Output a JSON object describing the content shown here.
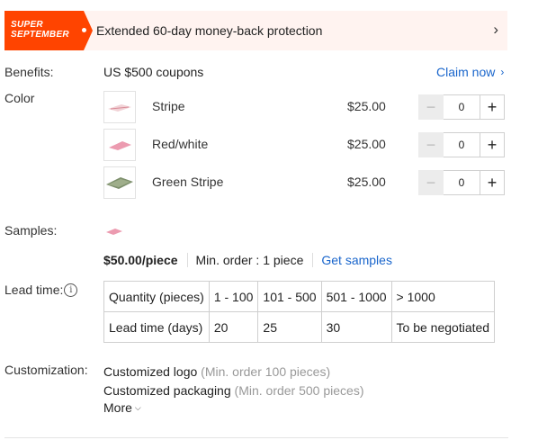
{
  "banner": {
    "badge_line1": "SUPER",
    "badge_line2": "SEPTEMBER",
    "text": "Extended 60-day money-back protection",
    "chevron": "›",
    "badge_color": "#ff4400",
    "background": "#fff3f0"
  },
  "benefits": {
    "label": "Benefits:",
    "value": "US $500 coupons",
    "claim_label": "Claim now",
    "claim_chevron": "›",
    "link_color": "#1a66cc"
  },
  "color": {
    "label": "Color",
    "options": [
      {
        "name": "Stripe",
        "price": "$25.00",
        "quantity": "0",
        "thumb_color": "#e8b9c0"
      },
      {
        "name": "Red/white",
        "price": "$25.00",
        "quantity": "0",
        "thumb_color": "#e890a6"
      },
      {
        "name": "Green Stripe",
        "price": "$25.00",
        "quantity": "0",
        "thumb_color": "#7d8f6c"
      }
    ],
    "minus_symbol": "−",
    "plus_symbol": "+"
  },
  "samples": {
    "label": "Samples:",
    "price": "$50.00/piece",
    "min_order": "Min. order : 1 piece",
    "link": "Get samples"
  },
  "lead_time": {
    "label": "Lead time:",
    "info_glyph": "i",
    "rows": [
      [
        "Quantity (pieces)",
        "1 - 100",
        "101 - 500",
        "501 - 1000",
        "> 1000"
      ],
      [
        "Lead time (days)",
        "20",
        "25",
        "30",
        "To be negotiated"
      ]
    ]
  },
  "customization": {
    "label": "Customization:",
    "items": [
      {
        "name": "Customized logo",
        "note": "(Min. order 100 pieces)"
      },
      {
        "name": "Customized packaging",
        "note": "(Min. order 500 pieces)"
      }
    ],
    "more_label": "More",
    "more_chevron": "⌄"
  }
}
